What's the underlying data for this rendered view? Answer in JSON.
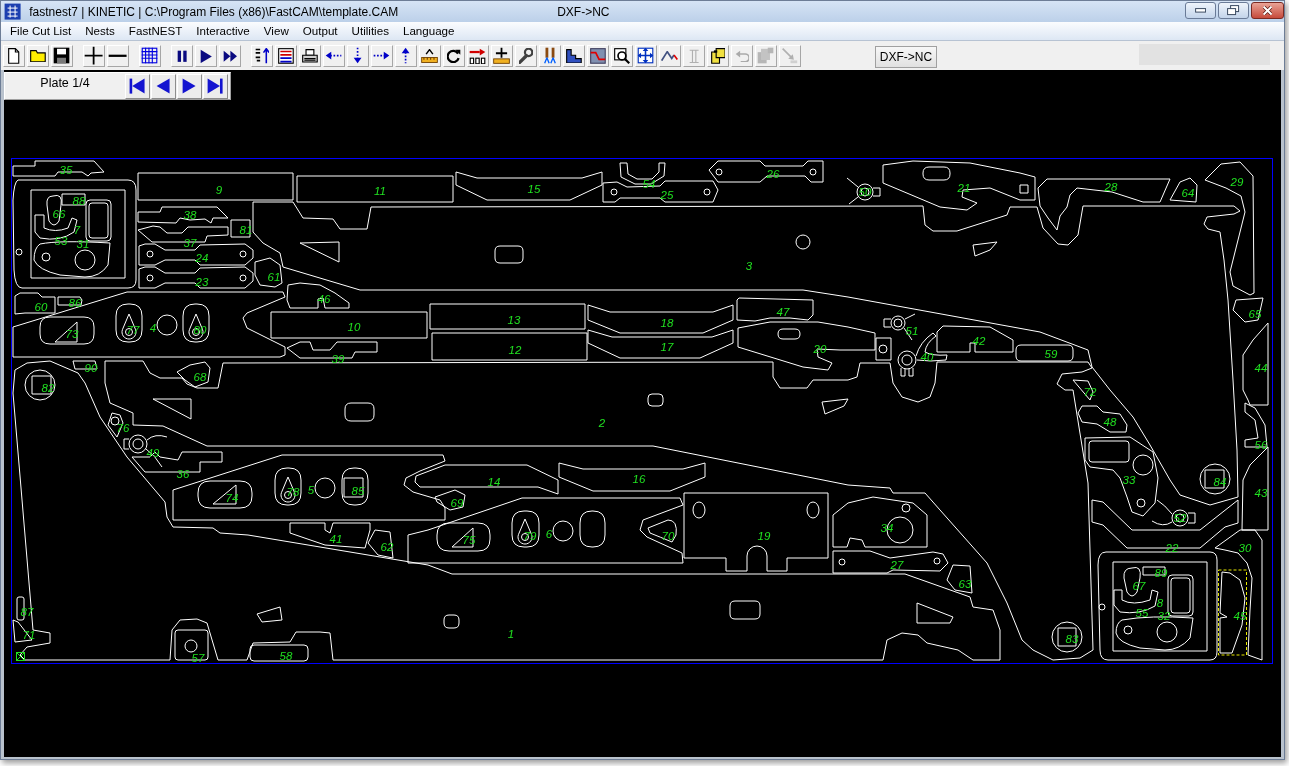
{
  "window": {
    "title": "fastnest7 | KINETIC | C:\\Program Files (x86)\\FastCAM\\template.CAM",
    "title_right": "DXF->NC"
  },
  "menu": [
    {
      "label": "File Cut List"
    },
    {
      "label": "Nests"
    },
    {
      "label": "FastNEST"
    },
    {
      "label": "Interactive"
    },
    {
      "label": "View"
    },
    {
      "label": "Output"
    },
    {
      "label": "Utilities"
    },
    {
      "label": "Language"
    }
  ],
  "toolbar": [
    {
      "buttons": [
        {
          "kind": "new",
          "disabled": false
        },
        {
          "kind": "open",
          "disabled": false
        },
        {
          "kind": "save",
          "disabled": false
        }
      ]
    },
    {
      "buttons": [
        {
          "kind": "plus",
          "disabled": false
        },
        {
          "kind": "minus",
          "disabled": false
        }
      ]
    },
    {
      "buttons": [
        {
          "kind": "grid",
          "disabled": false
        }
      ]
    },
    {
      "buttons": [
        {
          "kind": "pause",
          "disabled": false
        },
        {
          "kind": "play",
          "disabled": false
        },
        {
          "kind": "forward",
          "disabled": false
        }
      ]
    },
    {
      "buttons": [
        {
          "kind": "sort",
          "disabled": false
        },
        {
          "kind": "dnc",
          "disabled": false
        },
        {
          "kind": "print",
          "disabled": false
        },
        {
          "kind": "left",
          "disabled": false
        },
        {
          "kind": "down",
          "disabled": false
        },
        {
          "kind": "right",
          "disabled": false
        },
        {
          "kind": "up",
          "disabled": false
        },
        {
          "kind": "measure",
          "disabled": false
        },
        {
          "kind": "rotate",
          "disabled": false
        },
        {
          "kind": "send",
          "disabled": false
        },
        {
          "kind": "level",
          "disabled": false
        },
        {
          "kind": "wrench",
          "disabled": false
        },
        {
          "kind": "pins",
          "disabled": false
        },
        {
          "kind": "profile",
          "disabled": false
        },
        {
          "kind": "line",
          "disabled": false
        },
        {
          "kind": "zoom",
          "disabled": false
        },
        {
          "kind": "extents",
          "disabled": false
        },
        {
          "kind": "path",
          "disabled": false
        },
        {
          "kind": "ibeam",
          "disabled": true
        },
        {
          "kind": "paste",
          "disabled": false
        },
        {
          "kind": "undo",
          "disabled": true
        },
        {
          "kind": "stack",
          "disabled": true
        },
        {
          "kind": "export",
          "disabled": true
        }
      ]
    }
  ],
  "dxf_button": {
    "label": "DXF->NC"
  },
  "plate_nav": {
    "label": "Plate 1/4",
    "buttons": [
      {
        "kind": "first"
      },
      {
        "kind": "previous"
      },
      {
        "kind": "next"
      },
      {
        "kind": "last"
      }
    ]
  },
  "nest": {
    "parts": [
      {
        "label": "35",
        "selected": false
      },
      {
        "label": "26",
        "selected": false
      },
      {
        "label": "9",
        "selected": false
      },
      {
        "label": "11",
        "selected": false
      },
      {
        "label": "15",
        "selected": false
      },
      {
        "label": "54",
        "selected": false
      },
      {
        "label": "25",
        "selected": false
      },
      {
        "label": "50",
        "selected": false
      },
      {
        "label": "21",
        "selected": false
      },
      {
        "label": "28",
        "selected": false
      },
      {
        "label": "64",
        "selected": false
      },
      {
        "label": "29",
        "selected": false
      },
      {
        "label": "88",
        "selected": false
      },
      {
        "label": "66",
        "selected": false
      },
      {
        "label": "38",
        "selected": false
      },
      {
        "label": "7",
        "selected": false
      },
      {
        "label": "81",
        "selected": false
      },
      {
        "label": "53",
        "selected": false
      },
      {
        "label": "31",
        "selected": false
      },
      {
        "label": "37",
        "selected": false
      },
      {
        "label": "24",
        "selected": false
      },
      {
        "label": "3",
        "selected": false
      },
      {
        "label": "23",
        "selected": false
      },
      {
        "label": "61",
        "selected": false
      },
      {
        "label": "60",
        "selected": false
      },
      {
        "label": "86",
        "selected": false
      },
      {
        "label": "46",
        "selected": false
      },
      {
        "label": "47",
        "selected": false
      },
      {
        "label": "65",
        "selected": false
      },
      {
        "label": "73",
        "selected": false
      },
      {
        "label": "77",
        "selected": false
      },
      {
        "label": "4",
        "selected": false
      },
      {
        "label": "80",
        "selected": false
      },
      {
        "label": "10",
        "selected": false
      },
      {
        "label": "13",
        "selected": false
      },
      {
        "label": "18",
        "selected": false
      },
      {
        "label": "51",
        "selected": false
      },
      {
        "label": "42",
        "selected": false
      },
      {
        "label": "39",
        "selected": false
      },
      {
        "label": "12",
        "selected": false
      },
      {
        "label": "17",
        "selected": false
      },
      {
        "label": "20",
        "selected": false
      },
      {
        "label": "40",
        "selected": false
      },
      {
        "label": "59",
        "selected": false
      },
      {
        "label": "90",
        "selected": false
      },
      {
        "label": "44",
        "selected": false
      },
      {
        "label": "68",
        "selected": false
      },
      {
        "label": "82",
        "selected": false
      },
      {
        "label": "72",
        "selected": false
      },
      {
        "label": "76",
        "selected": false
      },
      {
        "label": "2",
        "selected": false
      },
      {
        "label": "48",
        "selected": false
      },
      {
        "label": "56",
        "selected": false
      },
      {
        "label": "49",
        "selected": false
      },
      {
        "label": "36",
        "selected": false
      },
      {
        "label": "14",
        "selected": false
      },
      {
        "label": "16",
        "selected": false
      },
      {
        "label": "33",
        "selected": false
      },
      {
        "label": "84",
        "selected": false
      },
      {
        "label": "74",
        "selected": false
      },
      {
        "label": "78",
        "selected": false
      },
      {
        "label": "5",
        "selected": false
      },
      {
        "label": "85",
        "selected": false
      },
      {
        "label": "69",
        "selected": false
      },
      {
        "label": "43",
        "selected": false
      },
      {
        "label": "52",
        "selected": false
      },
      {
        "label": "34",
        "selected": false
      },
      {
        "label": "41",
        "selected": false
      },
      {
        "label": "75",
        "selected": false
      },
      {
        "label": "79",
        "selected": false
      },
      {
        "label": "6",
        "selected": false
      },
      {
        "label": "70",
        "selected": false
      },
      {
        "label": "19",
        "selected": false
      },
      {
        "label": "62",
        "selected": false
      },
      {
        "label": "22",
        "selected": false
      },
      {
        "label": "30",
        "selected": false
      },
      {
        "label": "27",
        "selected": false
      },
      {
        "label": "89",
        "selected": false
      },
      {
        "label": "63",
        "selected": false
      },
      {
        "label": "67",
        "selected": false
      },
      {
        "label": "8",
        "selected": false
      },
      {
        "label": "87",
        "selected": false
      },
      {
        "label": "55",
        "selected": false
      },
      {
        "label": "32",
        "selected": false
      },
      {
        "label": "45",
        "selected": true
      },
      {
        "label": "71",
        "selected": false
      },
      {
        "label": "1",
        "selected": false
      },
      {
        "label": "83",
        "selected": false
      },
      {
        "label": "57",
        "selected": false
      },
      {
        "label": "58",
        "selected": false
      }
    ]
  }
}
